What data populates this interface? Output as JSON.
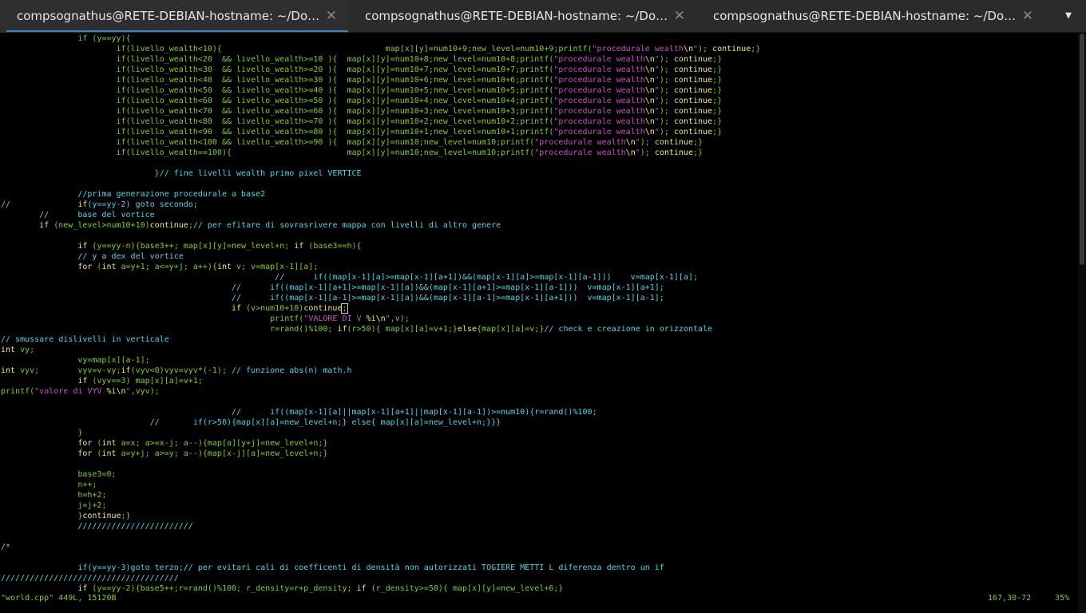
{
  "tabs": [
    {
      "title": "compsognathus@RETE-DEBIAN-hostname: ~/Documents/",
      "active": true
    },
    {
      "title": "compsognathus@RETE-DEBIAN-hostname: ~/Documents/",
      "active": false
    },
    {
      "title": "compsognathus@RETE-DEBIAN-hostname: ~/Documents/",
      "active": false
    }
  ],
  "icons": {
    "tab_close": "close-icon",
    "tab_menu": "chevron-down-icon"
  },
  "glyphs": {
    "close": "✕",
    "menu": "▼"
  },
  "colors": {
    "background": "#000000",
    "code_default": "#7fcf2c",
    "keyword": "#f0eb74",
    "comment_cyan": "#4fd6e8",
    "string_magenta": "#cc4ecc",
    "number_red": "#e05a5a",
    "tab_accent": "#3a86c8"
  },
  "code_lines": [
    [
      [
        "g",
        "                if (y==yy){"
      ]
    ],
    [
      [
        "g",
        "                        if(livello_wealth<10){                                  map[x][y]=num10+9;new_level=num10+9;printf("
      ],
      [
        "m",
        "\"procedurale wealth"
      ],
      [
        "y",
        "\\n"
      ],
      [
        "m",
        "\""
      ],
      [
        "g",
        "); "
      ],
      [
        "y",
        "continue"
      ],
      [
        "g",
        ";}"
      ]
    ],
    [
      [
        "g",
        "                        if(livello_wealth<20  && livello_wealth>=10 ){  map[x][y]=num10+8;new_level=num10+8;printf("
      ],
      [
        "m",
        "\"procedurale wealth"
      ],
      [
        "y",
        "\\n"
      ],
      [
        "m",
        "\""
      ],
      [
        "g",
        "); "
      ],
      [
        "y",
        "continue"
      ],
      [
        "g",
        ";}"
      ]
    ],
    [
      [
        "g",
        "                        if(livello_wealth<30  && livello_wealth>=20 ){  map[x][y]=num10+7;new_level=num10+7;printf("
      ],
      [
        "m",
        "\"procedurale wealth"
      ],
      [
        "y",
        "\\n"
      ],
      [
        "m",
        "\""
      ],
      [
        "g",
        "); "
      ],
      [
        "y",
        "continue"
      ],
      [
        "g",
        ";}"
      ]
    ],
    [
      [
        "g",
        "                        if(livello_wealth<40  && livello_wealth>=30 ){  map[x][y]=num10+6;new_level=num10+6;printf("
      ],
      [
        "m",
        "\"procedurale wealth"
      ],
      [
        "y",
        "\\n"
      ],
      [
        "m",
        "\""
      ],
      [
        "g",
        "); "
      ],
      [
        "y",
        "continue"
      ],
      [
        "g",
        ";}"
      ]
    ],
    [
      [
        "g",
        "                        if(livello_wealth<50  && livello_wealth>=40 ){  map[x][y]=num10+5;new_level=num10+5;printf("
      ],
      [
        "m",
        "\"procedurale wealth"
      ],
      [
        "y",
        "\\n"
      ],
      [
        "m",
        "\""
      ],
      [
        "g",
        "); "
      ],
      [
        "y",
        "continue"
      ],
      [
        "g",
        ";}"
      ]
    ],
    [
      [
        "g",
        "                        if(livello_wealth<60  && livello_wealth>=50 ){  map[x][y]=num10+4;new_level=num10+4;printf("
      ],
      [
        "m",
        "\"procedurale wealth"
      ],
      [
        "y",
        "\\n"
      ],
      [
        "m",
        "\""
      ],
      [
        "g",
        "); "
      ],
      [
        "y",
        "continue"
      ],
      [
        "g",
        ";}"
      ]
    ],
    [
      [
        "g",
        "                        if(livello_wealth<70  && livello_wealth>=60 ){  map[x][y]=num10+3;new_level=num10+3;printf("
      ],
      [
        "m",
        "\"procedurale wealth"
      ],
      [
        "y",
        "\\n"
      ],
      [
        "m",
        "\""
      ],
      [
        "g",
        "); "
      ],
      [
        "y",
        "continue"
      ],
      [
        "g",
        ";}"
      ]
    ],
    [
      [
        "g",
        "                        if(livello_wealth<80  && livello_wealth>=70 ){  map[x][y]=num10+2;new_level=num10+2;printf("
      ],
      [
        "m",
        "\"procedurale wealth"
      ],
      [
        "y",
        "\\n"
      ],
      [
        "m",
        "\""
      ],
      [
        "g",
        "); "
      ],
      [
        "y",
        "continue"
      ],
      [
        "g",
        ";}"
      ]
    ],
    [
      [
        "g",
        "                        if(livello_wealth<90  && livello_wealth>=80 ){  map[x][y]=num10+1;new_level=num10+1;printf("
      ],
      [
        "m",
        "\"procedurale wealth"
      ],
      [
        "y",
        "\\n"
      ],
      [
        "m",
        "\""
      ],
      [
        "g",
        "); "
      ],
      [
        "y",
        "continue"
      ],
      [
        "g",
        ";}"
      ]
    ],
    [
      [
        "g",
        "                        if(livello_wealth<100 && livello_wealth>=90 ){  map[x][y]=num10;new_level=num10;printf("
      ],
      [
        "m",
        "\"procedurale wealth"
      ],
      [
        "y",
        "\\n"
      ],
      [
        "m",
        "\""
      ],
      [
        "g",
        "); "
      ],
      [
        "y",
        "continue"
      ],
      [
        "g",
        ";}"
      ]
    ],
    [
      [
        "g",
        "                        if(livello_wealth==100){                        map[x][y]=num10;new_level=num10;printf("
      ],
      [
        "m",
        "\"procedurale wealth"
      ],
      [
        "y",
        "\\n"
      ],
      [
        "m",
        "\""
      ],
      [
        "g",
        "); "
      ],
      [
        "y",
        "continue"
      ],
      [
        "g",
        ";}"
      ]
    ],
    [
      [
        "g",
        ""
      ]
    ],
    [
      [
        "g",
        "                                }"
      ],
      [
        "c",
        "// fine livelli wealth primo pixel VERTICE"
      ]
    ],
    [
      [
        "g",
        ""
      ]
    ],
    [
      [
        "c",
        "                //prima generazione procedurale a base2"
      ]
    ],
    [
      [
        "c",
        "//              "
      ],
      [
        "y",
        "if"
      ],
      [
        "c",
        "(y==yy-2) goto secondo;"
      ]
    ],
    [
      [
        "c",
        "        //      base del vortice"
      ]
    ],
    [
      [
        "g",
        "        "
      ],
      [
        "y",
        "if"
      ],
      [
        "g",
        " (new_level>num10+10)"
      ],
      [
        "y",
        "continue"
      ],
      [
        "g",
        ";"
      ],
      [
        "c",
        "// per efitare di sovrasrivere mappa con livelli di altro genere"
      ]
    ],
    [
      [
        "g",
        ""
      ]
    ],
    [
      [
        "g",
        "                "
      ],
      [
        "y",
        "if"
      ],
      [
        "g",
        " (y==yy-n){base3++; map[x][y]=new_level+n; "
      ],
      [
        "y",
        "if"
      ],
      [
        "g",
        " (base3==h){"
      ]
    ],
    [
      [
        "c",
        "                // y a dex del vortice"
      ]
    ],
    [
      [
        "g",
        "                "
      ],
      [
        "y",
        "for"
      ],
      [
        "g",
        " ("
      ],
      [
        "y",
        "int"
      ],
      [
        "g",
        " a=y+1; a<=y+j; a++){"
      ],
      [
        "y",
        "int"
      ],
      [
        "g",
        " v; v=map[x-1][a];"
      ]
    ],
    [
      [
        "c",
        "                                                         //      if((map[x-1][a]>=map[x-1][a+1])&&(map[x-1][a]>=map[x-1][a-1]))    v=map[x-1][a];"
      ]
    ],
    [
      [
        "c",
        "                                                //      if((map[x-1][a+1]>=map[x-1][a])&&(map[x-1][a+1]>=map[x-1][a-1]))  v=map[x-1][a+1];"
      ]
    ],
    [
      [
        "c",
        "                                                //      if((map[x-1][a-1]>=map[x-1][a])&&(map[x-1][a-1]>=map[x-1][a+1]))  v=map[x-1][a-1];"
      ]
    ],
    [
      [
        "g",
        "                                                "
      ],
      [
        "y",
        "if"
      ],
      [
        "g",
        " (v>num10+10)"
      ],
      [
        "y",
        "continue"
      ],
      [
        "cur",
        ";"
      ]
    ],
    [
      [
        "g",
        "                                                        printf("
      ],
      [
        "m",
        "\"VALORE DI V "
      ],
      [
        "y",
        "%i\\n"
      ],
      [
        "m",
        "\""
      ],
      [
        "g",
        ",v);"
      ]
    ],
    [
      [
        "g",
        "                                                        r=rand()%100; "
      ],
      [
        "y",
        "if"
      ],
      [
        "g",
        "(r>50){ map[x][a]=v+1;}"
      ],
      [
        "y",
        "else"
      ],
      [
        "g",
        "{map[x][a]=v;}"
      ],
      [
        "c",
        "// check e creazione in orizzontale"
      ]
    ],
    [
      [
        "c",
        "// smussare dislivelli in verticale"
      ]
    ],
    [
      [
        "y",
        "int"
      ],
      [
        "g",
        " vy;"
      ]
    ],
    [
      [
        "g",
        "                vy=map[x][a-1];"
      ]
    ],
    [
      [
        "y",
        "int"
      ],
      [
        "g",
        " vyv;        vyv=v-vy;"
      ],
      [
        "y",
        "if"
      ],
      [
        "g",
        "(vyv<0)vyv=vyv*(-1); "
      ],
      [
        "c",
        "// funzione abs(n) math.h"
      ]
    ],
    [
      [
        "g",
        "                "
      ],
      [
        "y",
        "if"
      ],
      [
        "g",
        " (vyv==3) map[x][a]=v+1;"
      ]
    ],
    [
      [
        "g",
        "printf("
      ],
      [
        "m",
        "\"valore di VYV "
      ],
      [
        "y",
        "%i\\n"
      ],
      [
        "m",
        "\""
      ],
      [
        "g",
        ",vyv);"
      ]
    ],
    [
      [
        "g",
        ""
      ]
    ],
    [
      [
        "c",
        "                                                //      if((map[x-1][a]||map[x-1][a+1]||map[x-1][a-1])>=num10){r=rand()%100;"
      ]
    ],
    [
      [
        "c",
        "                               //       if(r>50){map[x][a]=new_level+n;} else{ map[x][a]=new_level+n;}}}"
      ]
    ],
    [
      [
        "g",
        "                }"
      ]
    ],
    [
      [
        "g",
        "                "
      ],
      [
        "y",
        "for"
      ],
      [
        "g",
        " ("
      ],
      [
        "y",
        "int"
      ],
      [
        "g",
        " a=x; a>=x-j; a--){map[a][y+j]=new_level+n;}"
      ]
    ],
    [
      [
        "g",
        "                "
      ],
      [
        "y",
        "for"
      ],
      [
        "g",
        " ("
      ],
      [
        "y",
        "int"
      ],
      [
        "g",
        " a=y+j; a>=y; a--){map[x-j][a]=new_level+n;}"
      ]
    ],
    [
      [
        "g",
        ""
      ]
    ],
    [
      [
        "g",
        "                base3=0;"
      ]
    ],
    [
      [
        "g",
        "                n++;"
      ]
    ],
    [
      [
        "g",
        "                h=h+2;"
      ]
    ],
    [
      [
        "g",
        "                j=j+2;"
      ]
    ],
    [
      [
        "g",
        "                }"
      ],
      [
        "y",
        "continue"
      ],
      [
        "g",
        ";}"
      ]
    ],
    [
      [
        "c",
        "                ////////////////////////"
      ]
    ],
    [
      [
        "g",
        ""
      ]
    ],
    [
      [
        "c",
        "/*"
      ]
    ],
    [
      [
        "g",
        ""
      ]
    ],
    [
      [
        "c",
        "                if(y==yy-3)goto terzo;// per evitari cali di coefficenti di densità non autorizzati TOGIERE METTI L diferenza dentro un if"
      ]
    ],
    [
      [
        "c",
        "/////////////////////////////////////"
      ]
    ],
    [
      [
        "g",
        "                "
      ],
      [
        "y",
        "if"
      ],
      [
        "g",
        " (y==yy-2){base5++;r=rand()%100; r_density=r+p_density; "
      ],
      [
        "y",
        "if"
      ],
      [
        "g",
        " (r_density>=50){ map[x][y]=new_level+6;}"
      ]
    ]
  ],
  "status": {
    "file": "\"world.cpp\" 449L, 15120B",
    "position": "167,30-72",
    "percent": "35%"
  }
}
